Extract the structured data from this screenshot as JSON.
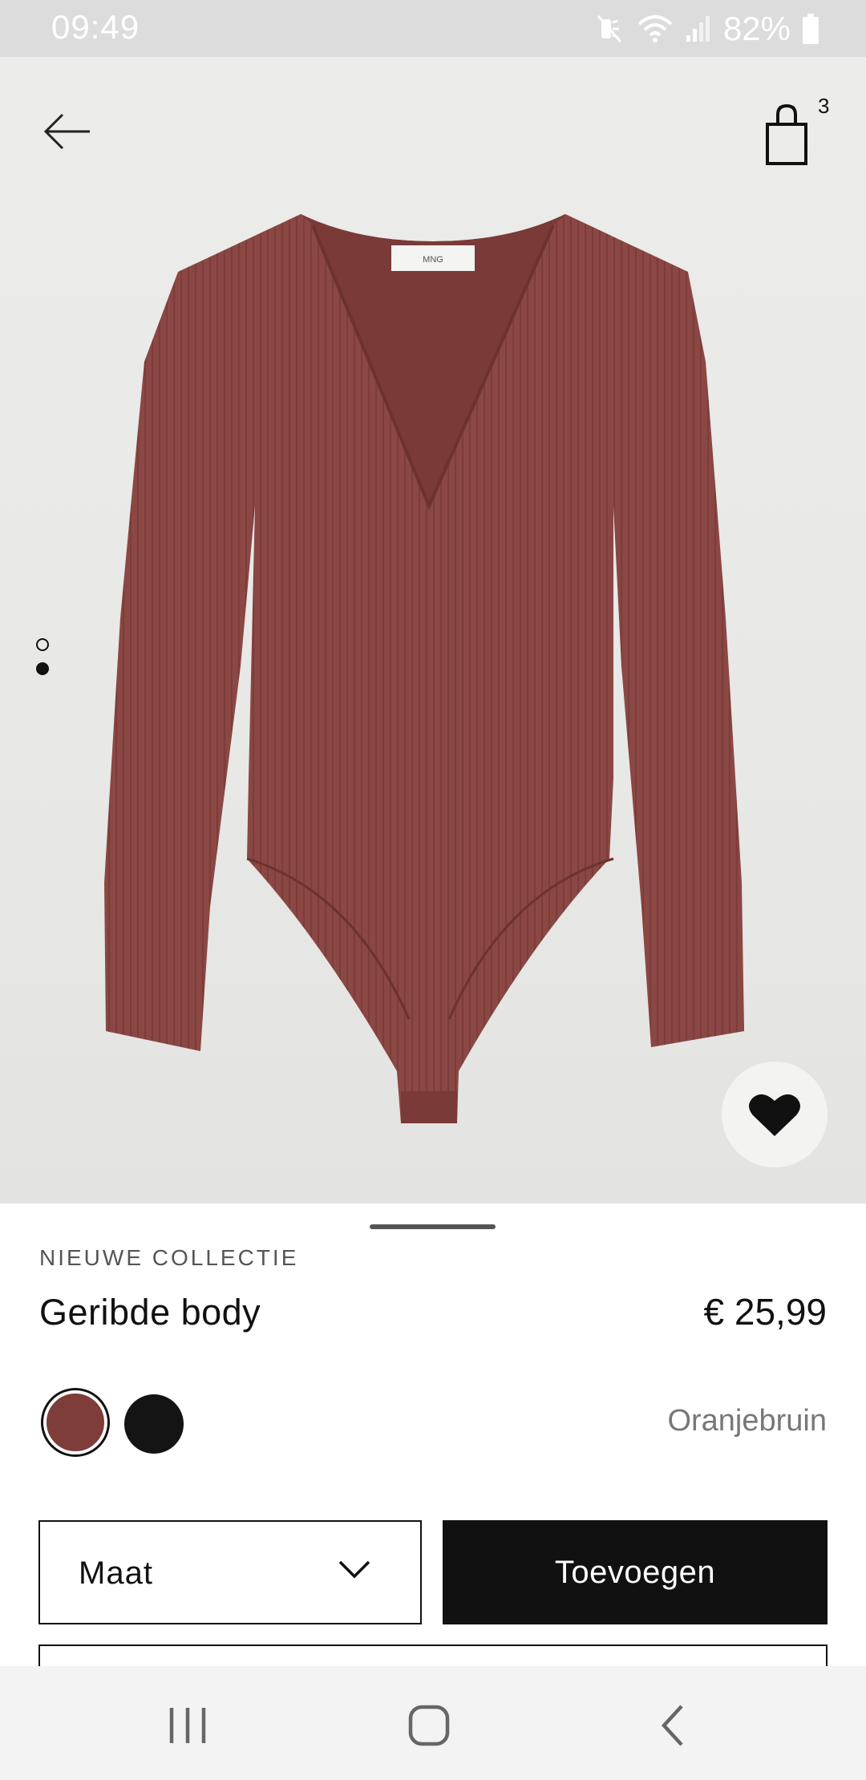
{
  "status_bar": {
    "time": "09:49",
    "battery": "82%",
    "icons": [
      "mute-icon",
      "wifi-icon",
      "signal-icon",
      "battery-icon"
    ]
  },
  "header": {
    "back_icon": "arrow-left-icon",
    "bag_icon": "shopping-bag-icon",
    "bag_count": "3"
  },
  "gallery": {
    "page_count": 2,
    "active_page": 2
  },
  "product": {
    "collection": "NIEUWE COLLECTIE",
    "name": "Geribde body",
    "price": "€ 25,99",
    "color_name": "Oranjebruin",
    "colors": [
      {
        "name": "Oranjebruin",
        "hex": "#7e3d39",
        "selected": true
      },
      {
        "name": "Zwart",
        "hex": "#141414",
        "selected": false
      }
    ],
    "favorite": true
  },
  "actions": {
    "size_label": "Maat",
    "add_label": "Toevoegen"
  },
  "nav_bar": {
    "icons": [
      "recent-apps-icon",
      "home-icon",
      "back-icon"
    ]
  },
  "theme": {
    "primary": "#111111",
    "garment_color": "#8a4744",
    "status_bar_bg": "#dcdcdc"
  }
}
